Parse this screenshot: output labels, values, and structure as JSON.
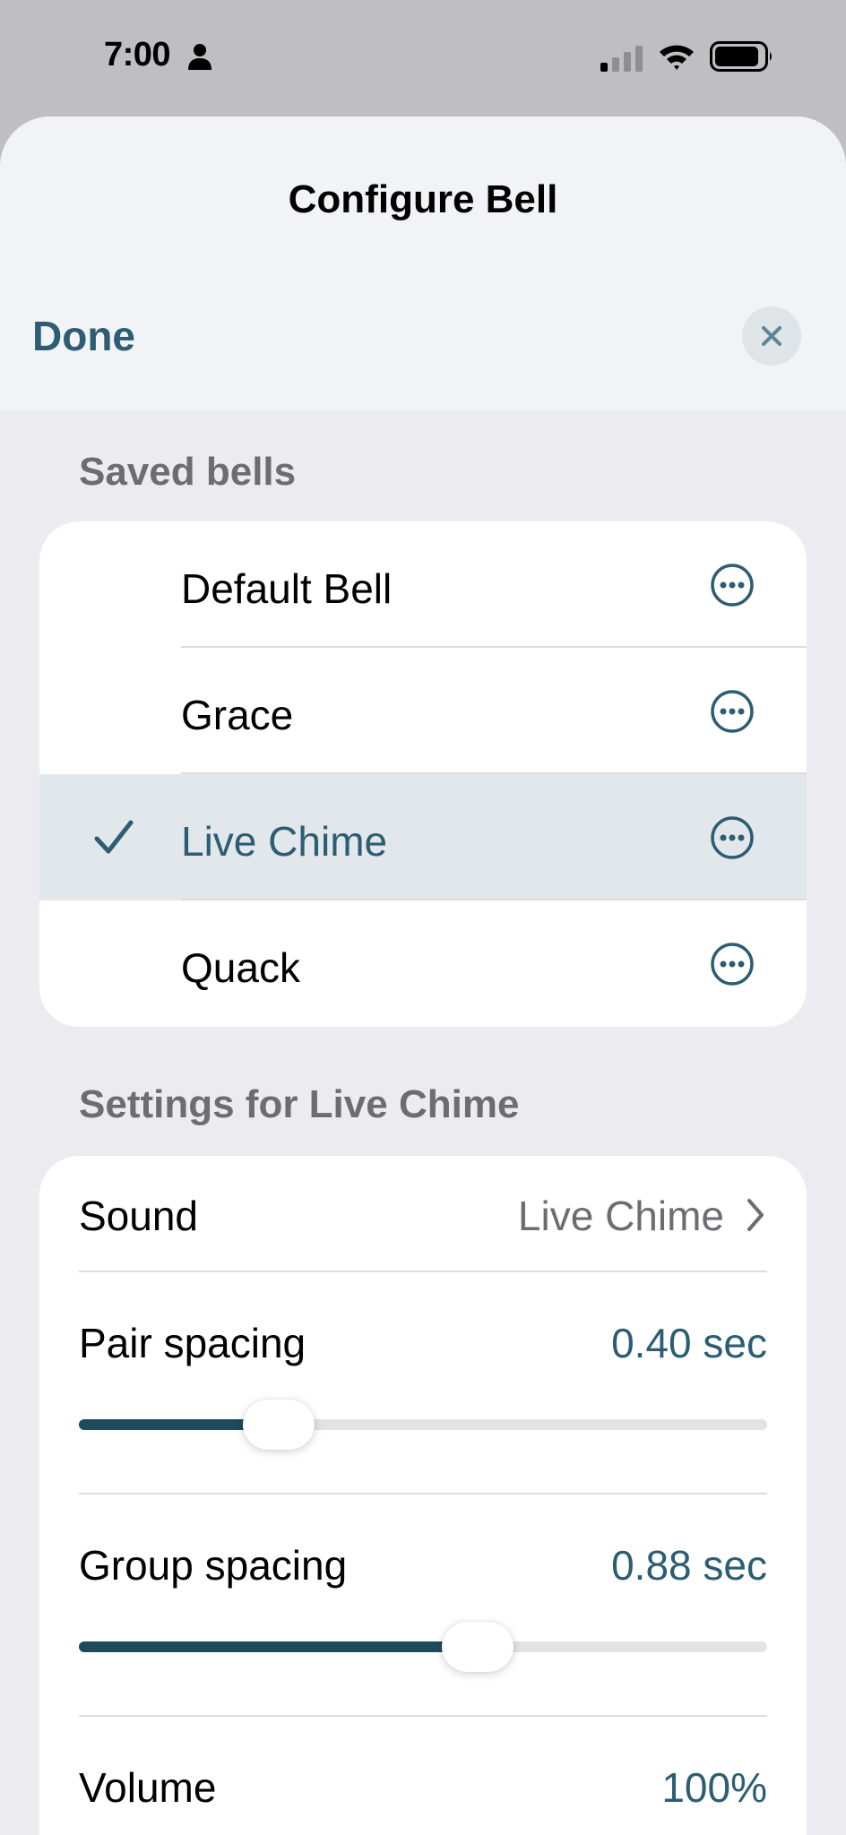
{
  "status_bar": {
    "time": "7:00"
  },
  "sheet": {
    "title": "Configure Bell",
    "done_label": "Done"
  },
  "saved_bells": {
    "header": "Saved bells",
    "items": [
      {
        "label": "Default Bell",
        "selected": false
      },
      {
        "label": "Grace",
        "selected": false
      },
      {
        "label": "Live Chime",
        "selected": true
      },
      {
        "label": "Quack",
        "selected": false
      }
    ]
  },
  "settings": {
    "header": "Settings for Live Chime",
    "sound": {
      "label": "Sound",
      "value": "Live Chime"
    },
    "pair_spacing": {
      "label": "Pair spacing",
      "value": "0.40 sec",
      "fraction": 0.29
    },
    "group_spacing": {
      "label": "Group spacing",
      "value": "0.88 sec",
      "fraction": 0.58
    },
    "volume": {
      "label": "Volume",
      "value": "100%"
    }
  },
  "colors": {
    "accent": "#2c5d72",
    "slider_fill": "#1f4a5c",
    "selected_row": "#e1e7eb"
  }
}
